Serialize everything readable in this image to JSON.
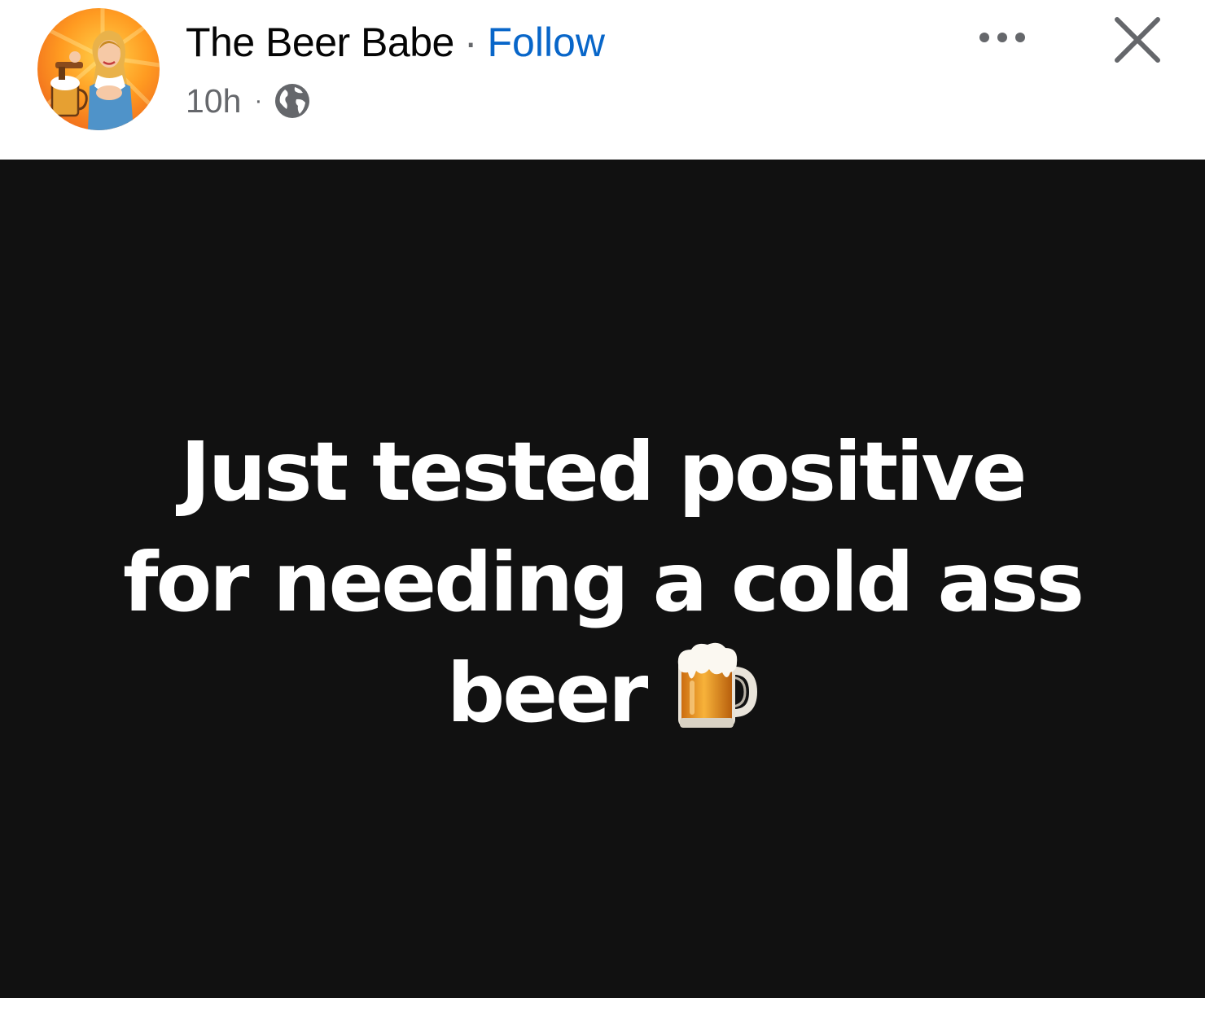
{
  "header": {
    "author_name": "The Beer Babe",
    "separator": "·",
    "follow_label": "Follow",
    "timestamp": "10h",
    "meta_separator": "·",
    "audience_icon": "globe-icon",
    "more_icon": "more-options-icon",
    "close_icon": "close-icon"
  },
  "post": {
    "background_color": "#111111",
    "text_color": "#ffffff",
    "line1": "Just tested positive",
    "line2": "for needing a cold ass",
    "line3": "beer",
    "emoji_icon": "beer-mug-icon"
  },
  "colors": {
    "link": "#0866c9",
    "secondary_text": "#65676b",
    "primary_text": "#050505"
  }
}
